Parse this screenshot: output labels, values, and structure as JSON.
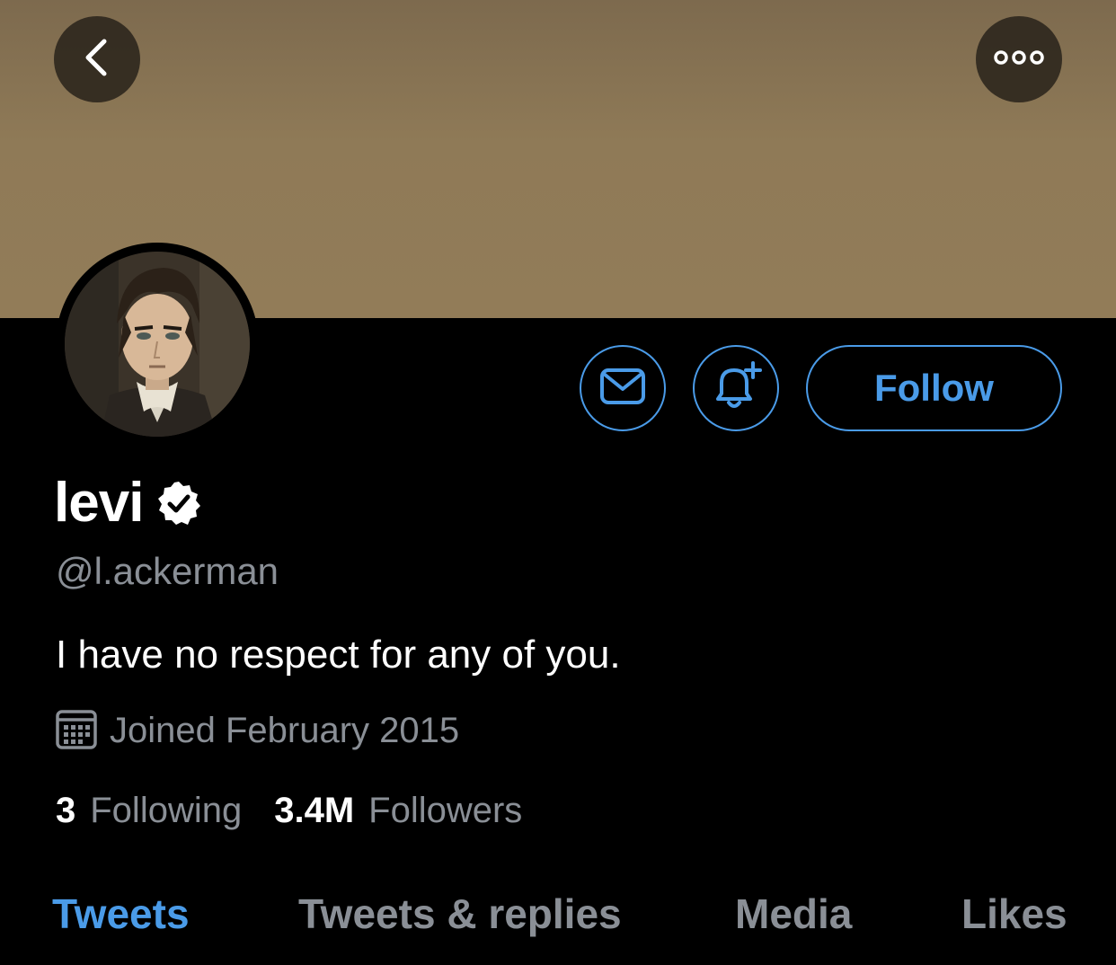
{
  "header": {
    "back_icon": "chevron-left-icon",
    "more_icon": "more-horizontal-icon"
  },
  "colors": {
    "accent": "#4a9be8",
    "banner": "#8f7a57",
    "muted_text": "#8a8f96",
    "background": "#000000"
  },
  "profile": {
    "display_name": "levi",
    "verified_icon": "verified-badge-icon",
    "handle": "@l.ackerman",
    "bio": "I have no respect for any of you.",
    "joined_icon": "calendar-icon",
    "joined": "Joined February 2015"
  },
  "actions": {
    "message_icon": "envelope-icon",
    "notify_icon": "bell-plus-icon",
    "follow_label": "Follow"
  },
  "stats": {
    "following_count": "3",
    "following_label": "Following",
    "followers_count": "3.4M",
    "followers_label": "Followers"
  },
  "tabs": [
    {
      "label": "Tweets",
      "active": true
    },
    {
      "label": "Tweets & replies",
      "active": false
    },
    {
      "label": "Media",
      "active": false
    },
    {
      "label": "Likes",
      "active": false
    }
  ]
}
